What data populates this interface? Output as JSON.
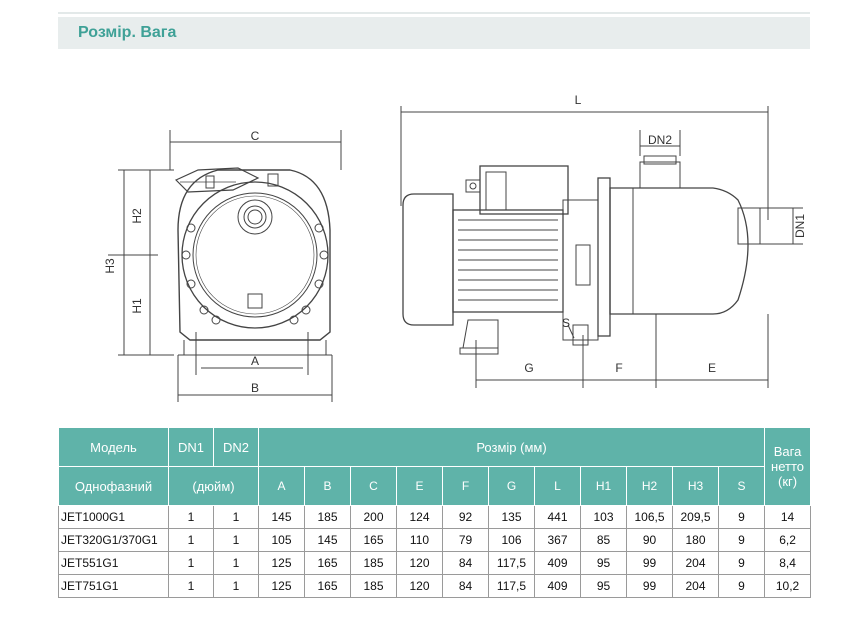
{
  "header": {
    "title": "Розмір. Вага"
  },
  "drawing": {
    "front_labels": {
      "c": "C",
      "h2": "H2",
      "h3": "H3",
      "h1": "H1",
      "a": "A",
      "b": "B"
    },
    "side_labels": {
      "l": "L",
      "dn2": "DN2",
      "dn1": "DN1",
      "s": "S",
      "g": "G",
      "f": "F",
      "e": "E"
    }
  },
  "table": {
    "head": {
      "model": "Модель",
      "phase": "Однофазний",
      "dn1": "DN1",
      "dn2": "DN2",
      "inch": "(дюйм)",
      "size_mm": "Розмір (мм)",
      "weight": "Вага нетто",
      "weight_unit": "(кг)",
      "cols": [
        "A",
        "B",
        "C",
        "E",
        "F",
        "G",
        "L",
        "H1",
        "H2",
        "H3",
        "S"
      ]
    },
    "rows": [
      {
        "model": "JET1000G1",
        "dn1": "1",
        "dn2": "1",
        "vals": [
          "145",
          "185",
          "200",
          "124",
          "92",
          "135",
          "441",
          "103",
          "106,5",
          "209,5",
          "9"
        ],
        "weight": "14"
      },
      {
        "model": "JET320G1/370G1",
        "dn1": "1",
        "dn2": "1",
        "vals": [
          "105",
          "145",
          "165",
          "110",
          "79",
          "106",
          "367",
          "85",
          "90",
          "180",
          "9"
        ],
        "weight": "6,2"
      },
      {
        "model": "JET551G1",
        "dn1": "1",
        "dn2": "1",
        "vals": [
          "125",
          "165",
          "185",
          "120",
          "84",
          "117,5",
          "409",
          "95",
          "99",
          "204",
          "9"
        ],
        "weight": "8,4"
      },
      {
        "model": "JET751G1",
        "dn1": "1",
        "dn2": "1",
        "vals": [
          "125",
          "165",
          "185",
          "120",
          "84",
          "117,5",
          "409",
          "95",
          "99",
          "204",
          "9"
        ],
        "weight": "10,2"
      }
    ]
  },
  "colors": {
    "accent": "#3fa197",
    "table_header": "#5fb3a9",
    "header_bar": "#e8eded"
  }
}
